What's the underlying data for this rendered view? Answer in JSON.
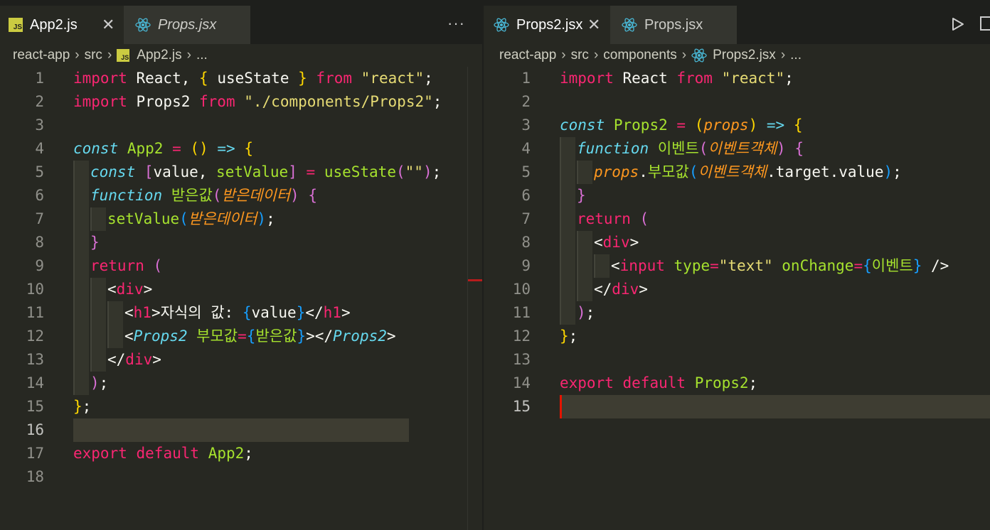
{
  "left": {
    "tabs": [
      {
        "label": "App2.js",
        "icon": "js-icon",
        "active": true,
        "italic": false
      },
      {
        "label": "Props.jsx",
        "icon": "react-icon",
        "active": false,
        "italic": true
      }
    ],
    "more_actions": "···",
    "breadcrumb": [
      "react-app",
      "src",
      "App2.js",
      "..."
    ],
    "current_line": 16,
    "lines": [
      {
        "n": "1",
        "tokens": [
          [
            "k",
            "import"
          ],
          [
            "w",
            " React, "
          ],
          [
            "b1",
            "{"
          ],
          [
            "w",
            " useState "
          ],
          [
            "b1",
            "}"
          ],
          [
            "w",
            " "
          ],
          [
            "k",
            "from"
          ],
          [
            "w",
            " "
          ],
          [
            "s",
            "\"react\""
          ],
          [
            "w",
            ";"
          ]
        ]
      },
      {
        "n": "2",
        "tokens": [
          [
            "k",
            "import"
          ],
          [
            "w",
            " Props2 "
          ],
          [
            "k",
            "from"
          ],
          [
            "w",
            " "
          ],
          [
            "s",
            "\"./components/Props2\""
          ],
          [
            "w",
            ";"
          ]
        ]
      },
      {
        "n": "3",
        "tokens": []
      },
      {
        "n": "4",
        "tokens": [
          [
            "st",
            "const"
          ],
          [
            "w",
            " "
          ],
          [
            "f",
            "App2"
          ],
          [
            "w",
            " "
          ],
          [
            "k",
            "="
          ],
          [
            "w",
            " "
          ],
          [
            "b1",
            "()"
          ],
          [
            "w",
            " "
          ],
          [
            "st",
            "=>"
          ],
          [
            "w",
            " "
          ],
          [
            "b1",
            "{"
          ]
        ]
      },
      {
        "n": "5",
        "tokens": [
          [
            "st",
            "const"
          ],
          [
            "w",
            " "
          ],
          [
            "b2",
            "["
          ],
          [
            "w",
            "value, "
          ],
          [
            "f",
            "setValue"
          ],
          [
            "b2",
            "]"
          ],
          [
            "w",
            " "
          ],
          [
            "k",
            "="
          ],
          [
            "w",
            " "
          ],
          [
            "f",
            "useState"
          ],
          [
            "b2",
            "("
          ],
          [
            "s",
            "\"\""
          ],
          [
            "b2",
            ")"
          ],
          [
            "w",
            ";"
          ]
        ]
      },
      {
        "n": "6",
        "tokens": [
          [
            "st",
            "function"
          ],
          [
            "w",
            " "
          ],
          [
            "f",
            "받은값"
          ],
          [
            "b2",
            "("
          ],
          [
            "p",
            "받은데이터"
          ],
          [
            "b2",
            ")"
          ],
          [
            "w",
            " "
          ],
          [
            "b2",
            "{"
          ]
        ]
      },
      {
        "n": "7",
        "tokens": [
          [
            "f",
            "setValue"
          ],
          [
            "b3",
            "("
          ],
          [
            "p",
            "받은데이터"
          ],
          [
            "b3",
            ")"
          ],
          [
            "w",
            ";"
          ]
        ]
      },
      {
        "n": "8",
        "tokens": [
          [
            "b2",
            "}"
          ]
        ]
      },
      {
        "n": "9",
        "tokens": [
          [
            "k",
            "return"
          ],
          [
            "w",
            " "
          ],
          [
            "b2",
            "("
          ]
        ]
      },
      {
        "n": "10",
        "tokens": [
          [
            "w",
            "<"
          ],
          [
            "k",
            "div"
          ],
          [
            "w",
            ">"
          ]
        ]
      },
      {
        "n": "11",
        "tokens": [
          [
            "w",
            "<"
          ],
          [
            "k",
            "h1"
          ],
          [
            "w",
            ">자식의 값: "
          ],
          [
            "b3",
            "{"
          ],
          [
            "w",
            "value"
          ],
          [
            "b3",
            "}"
          ],
          [
            "w",
            "</"
          ],
          [
            "k",
            "h1"
          ],
          [
            "w",
            ">"
          ]
        ]
      },
      {
        "n": "12",
        "tokens": [
          [
            "w",
            "<"
          ],
          [
            "st",
            "Props2"
          ],
          [
            "w",
            " "
          ],
          [
            "f",
            "부모값"
          ],
          [
            "k",
            "="
          ],
          [
            "b3",
            "{"
          ],
          [
            "f",
            "받은값"
          ],
          [
            "b3",
            "}"
          ],
          [
            "w",
            "></"
          ],
          [
            "st",
            "Props2"
          ],
          [
            "w",
            ">"
          ]
        ]
      },
      {
        "n": "13",
        "tokens": [
          [
            "w",
            "</"
          ],
          [
            "k",
            "div"
          ],
          [
            "w",
            ">"
          ]
        ]
      },
      {
        "n": "14",
        "tokens": [
          [
            "b2",
            ")"
          ],
          [
            "w",
            ";"
          ]
        ]
      },
      {
        "n": "15",
        "tokens": [
          [
            "b1",
            "}"
          ],
          [
            "w",
            ";"
          ]
        ]
      },
      {
        "n": "16",
        "tokens": []
      },
      {
        "n": "17",
        "tokens": [
          [
            "k",
            "export"
          ],
          [
            "w",
            " "
          ],
          [
            "k",
            "default"
          ],
          [
            "w",
            " "
          ],
          [
            "f",
            "App2"
          ],
          [
            "w",
            ";"
          ]
        ]
      },
      {
        "n": "18",
        "tokens": []
      }
    ]
  },
  "right": {
    "tabs": [
      {
        "label": "Props2.jsx",
        "icon": "react-icon",
        "active": true,
        "italic": false
      },
      {
        "label": "Props.jsx",
        "icon": "react-icon",
        "active": false,
        "italic": false
      }
    ],
    "breadcrumb": [
      "react-app",
      "src",
      "components",
      "Props2.jsx",
      "..."
    ],
    "current_line": 15,
    "lines": [
      {
        "n": "1",
        "tokens": [
          [
            "k",
            "import"
          ],
          [
            "w",
            " React "
          ],
          [
            "k",
            "from"
          ],
          [
            "w",
            " "
          ],
          [
            "s",
            "\"react\""
          ],
          [
            "w",
            ";"
          ]
        ]
      },
      {
        "n": "2",
        "tokens": []
      },
      {
        "n": "3",
        "tokens": [
          [
            "st",
            "const"
          ],
          [
            "w",
            " "
          ],
          [
            "f",
            "Props2"
          ],
          [
            "w",
            " "
          ],
          [
            "k",
            "="
          ],
          [
            "w",
            " "
          ],
          [
            "b1",
            "("
          ],
          [
            "p",
            "props"
          ],
          [
            "b1",
            ")"
          ],
          [
            "w",
            " "
          ],
          [
            "st",
            "=>"
          ],
          [
            "w",
            " "
          ],
          [
            "b1",
            "{"
          ]
        ]
      },
      {
        "n": "4",
        "tokens": [
          [
            "st",
            "function"
          ],
          [
            "w",
            " "
          ],
          [
            "f",
            "이벤트"
          ],
          [
            "b2",
            "("
          ],
          [
            "p",
            "이벤트객체"
          ],
          [
            "b2",
            ")"
          ],
          [
            "w",
            " "
          ],
          [
            "b2",
            "{"
          ]
        ]
      },
      {
        "n": "5",
        "tokens": [
          [
            "p",
            "props"
          ],
          [
            "w",
            "."
          ],
          [
            "f",
            "부모값"
          ],
          [
            "b3",
            "("
          ],
          [
            "p",
            "이벤트객체"
          ],
          [
            "w",
            ".target.value"
          ],
          [
            "b3",
            ")"
          ],
          [
            "w",
            ";"
          ]
        ]
      },
      {
        "n": "6",
        "tokens": [
          [
            "b2",
            "}"
          ]
        ]
      },
      {
        "n": "7",
        "tokens": [
          [
            "k",
            "return"
          ],
          [
            "w",
            " "
          ],
          [
            "b2",
            "("
          ]
        ]
      },
      {
        "n": "8",
        "tokens": [
          [
            "w",
            "<"
          ],
          [
            "k",
            "div"
          ],
          [
            "w",
            ">"
          ]
        ]
      },
      {
        "n": "9",
        "tokens": [
          [
            "w",
            "<"
          ],
          [
            "k",
            "input"
          ],
          [
            "w",
            " "
          ],
          [
            "f",
            "type"
          ],
          [
            "k",
            "="
          ],
          [
            "s",
            "\"text\""
          ],
          [
            "w",
            " "
          ],
          [
            "f",
            "onChange"
          ],
          [
            "k",
            "="
          ],
          [
            "b3",
            "{"
          ],
          [
            "f",
            "이벤트"
          ],
          [
            "b3",
            "}"
          ],
          [
            "w",
            " />"
          ]
        ]
      },
      {
        "n": "10",
        "tokens": [
          [
            "w",
            "</"
          ],
          [
            "k",
            "div"
          ],
          [
            "w",
            ">"
          ]
        ]
      },
      {
        "n": "11",
        "tokens": [
          [
            "b2",
            ")"
          ],
          [
            "w",
            ";"
          ]
        ]
      },
      {
        "n": "12",
        "tokens": [
          [
            "b1",
            "}"
          ],
          [
            "w",
            ";"
          ]
        ]
      },
      {
        "n": "13",
        "tokens": []
      },
      {
        "n": "14",
        "tokens": [
          [
            "k",
            "export"
          ],
          [
            "w",
            " "
          ],
          [
            "k",
            "default"
          ],
          [
            "w",
            " "
          ],
          [
            "f",
            "Props2"
          ],
          [
            "w",
            ";"
          ]
        ]
      },
      {
        "n": "15",
        "tokens": []
      }
    ]
  },
  "colors": {
    "editor_bg": "#272822",
    "keyword": "#f92672",
    "string": "#e6db74",
    "function": "#a6e22e",
    "storage": "#66d9ef",
    "parameter": "#fd971f",
    "bracket_gold": "#ffd700",
    "bracket_orchid": "#da70d6",
    "bracket_blue": "#179fff"
  }
}
